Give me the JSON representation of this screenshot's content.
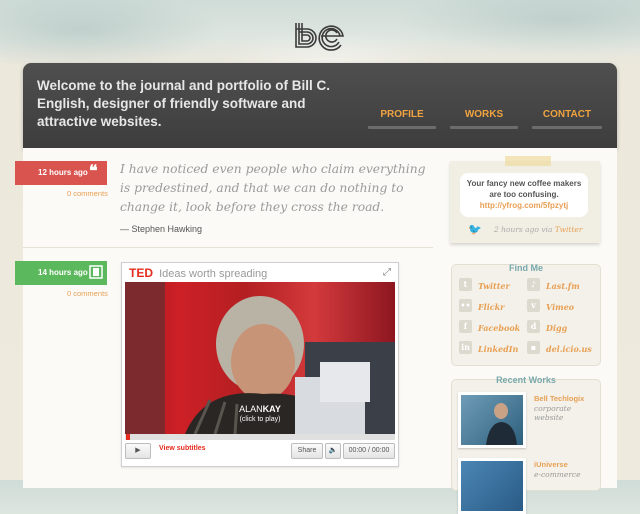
{
  "site": {
    "logo_text": "be"
  },
  "header": {
    "welcome": "Welcome to the journal and portfolio of Bill C. English, designer of friendly software and attractive websites.",
    "nav": [
      {
        "label": "PROFILE"
      },
      {
        "label": "WORKS"
      },
      {
        "label": "CONTACT"
      }
    ]
  },
  "posts": [
    {
      "timestamp": "12 hours ago",
      "comments": "0 comments",
      "icon": "quote-icon",
      "quote": "I have noticed even people who claim everything is predestined, and that we can do nothing to change it, look before they cross the road.",
      "author": "— Stephen Hawking",
      "color": "#d9534f"
    },
    {
      "timestamp": "14 hours ago",
      "comments": "0 comments",
      "icon": "film-icon",
      "color": "#5cb85c",
      "video": {
        "brand": "TED",
        "tagline": "Ideas worth spreading",
        "speaker_first": "ALAN",
        "speaker_last": "KAY",
        "click_hint": "(click to play)",
        "subtitles": "View subtitles",
        "share": "Share",
        "time": "00:00 / 00:00"
      }
    }
  ],
  "twitter": {
    "text": "Your fancy new coffee makers are too confusing.",
    "link": "http://yfrog.com/5fpzytj",
    "meta_time": "2 hours ago via",
    "meta_source": "Twitter"
  },
  "find_me": {
    "title": "Find Me",
    "items": [
      {
        "label": "Twitter"
      },
      {
        "label": "Last.fm"
      },
      {
        "label": "Flickr"
      },
      {
        "label": "Vimeo"
      },
      {
        "label": "Facebook"
      },
      {
        "label": "Digg"
      },
      {
        "label": "LinkedIn"
      },
      {
        "label": "del.icio.us"
      }
    ]
  },
  "recent_works": {
    "title": "Recent Works",
    "items": [
      {
        "title": "Bell Techlogix",
        "subtitle": "corporate website"
      },
      {
        "title": "iUniverse",
        "subtitle": "e-commerce"
      }
    ]
  }
}
